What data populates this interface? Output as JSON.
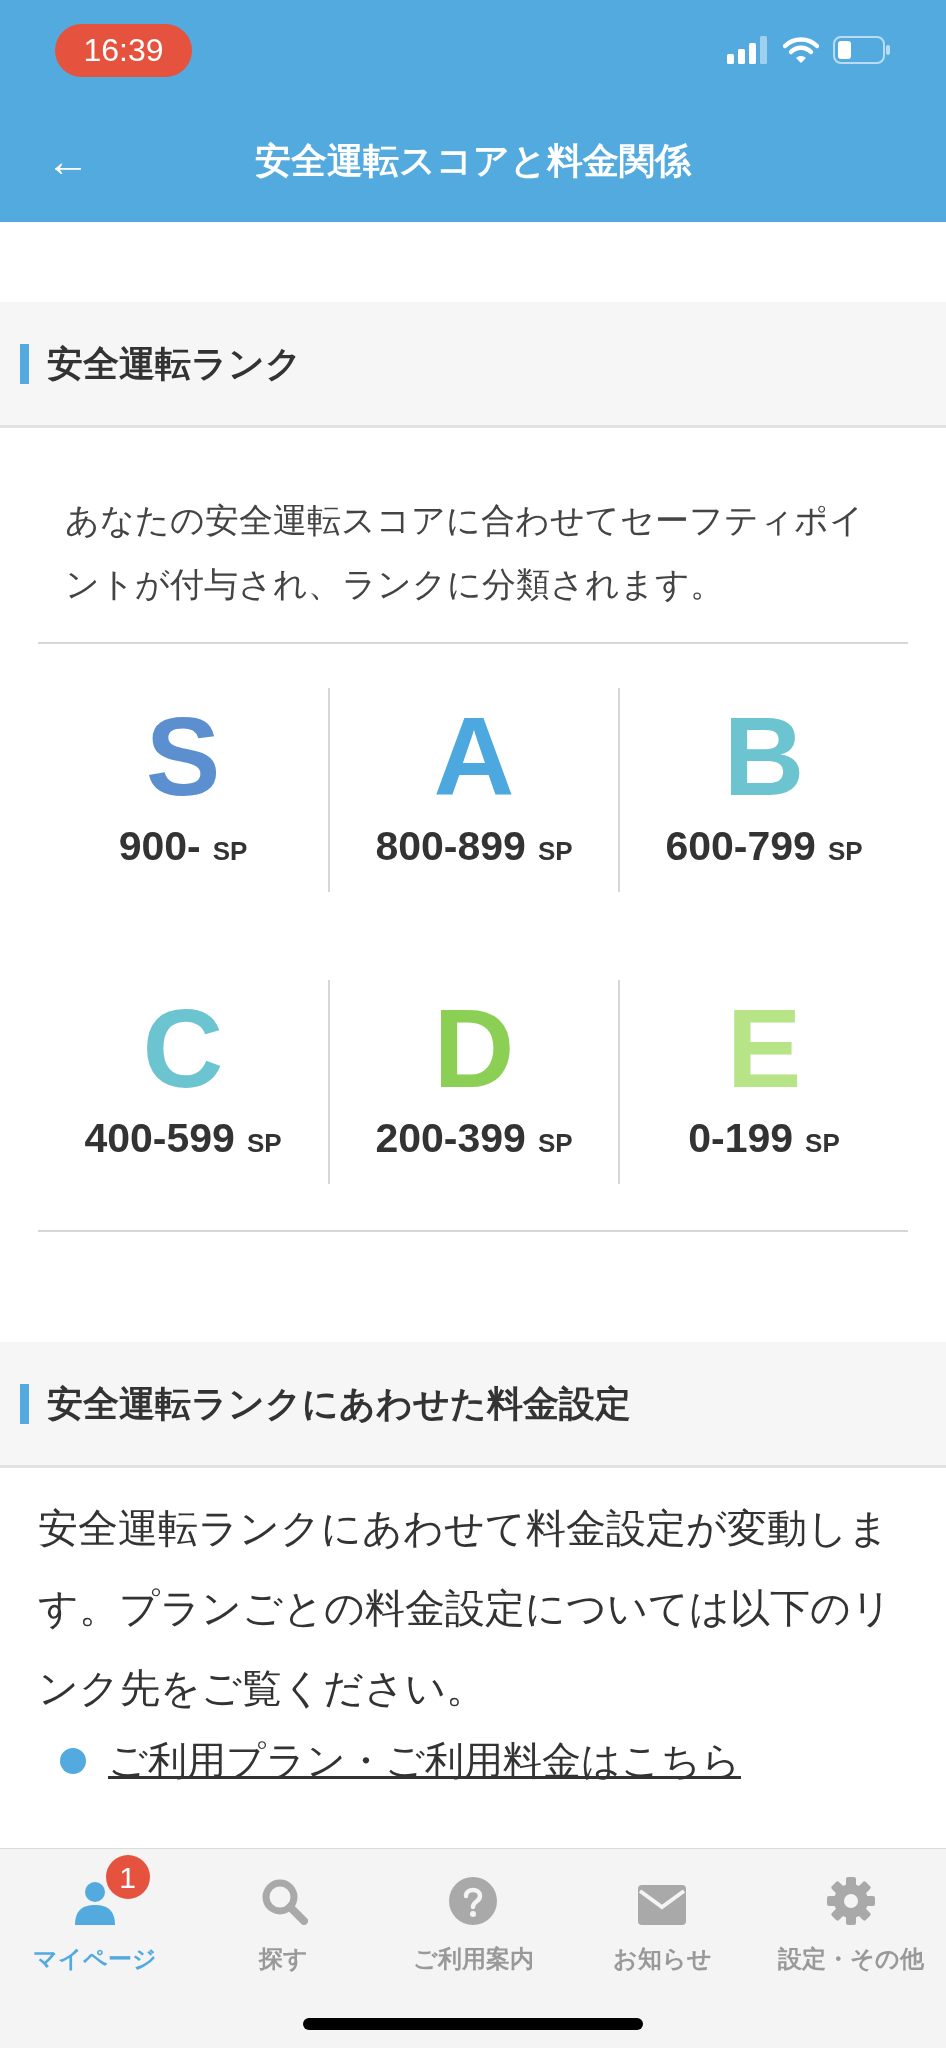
{
  "status_bar": {
    "time": "16:39"
  },
  "header": {
    "back": "←",
    "title": "安全運転スコアと料金関係"
  },
  "rank_section": {
    "heading": "安全運転ランク",
    "description": "あなたの安全運転スコアに合わせてセーフティポイントが付与され、ランクに分類されます。",
    "ranks": [
      {
        "letter": "S",
        "range": "900-",
        "unit": "SP",
        "color": "#5b8fcf"
      },
      {
        "letter": "A",
        "range": "800-899",
        "unit": "SP",
        "color": "#4ca8df"
      },
      {
        "letter": "B",
        "range": "600-799",
        "unit": "SP",
        "color": "#6cc4d0"
      },
      {
        "letter": "C",
        "range": "400-599",
        "unit": "SP",
        "color": "#6cc4d0"
      },
      {
        "letter": "D",
        "range": "200-399",
        "unit": "SP",
        "color": "#8ccf55"
      },
      {
        "letter": "E",
        "range": "0-199",
        "unit": "SP",
        "color": "#b6e486"
      }
    ]
  },
  "fee_section": {
    "heading": "安全運転ランクにあわせた料金設定",
    "paragraph": "安全運転ランクにあわせて料金設定が変動します。プランごとの料金設定については以下のリンク先をご覧ください。",
    "links": [
      "ご利用プラン・ご利用料金はこちら"
    ]
  },
  "tab_bar": [
    {
      "kind": "person",
      "label": "マイページ",
      "selected": true,
      "badge": "1"
    },
    {
      "kind": "search",
      "label": "探す",
      "selected": false
    },
    {
      "kind": "help",
      "label": "ご利用案内",
      "selected": false
    },
    {
      "kind": "mail",
      "label": "お知らせ",
      "selected": false
    },
    {
      "kind": "gear",
      "label": "設定・その他",
      "selected": false
    }
  ]
}
